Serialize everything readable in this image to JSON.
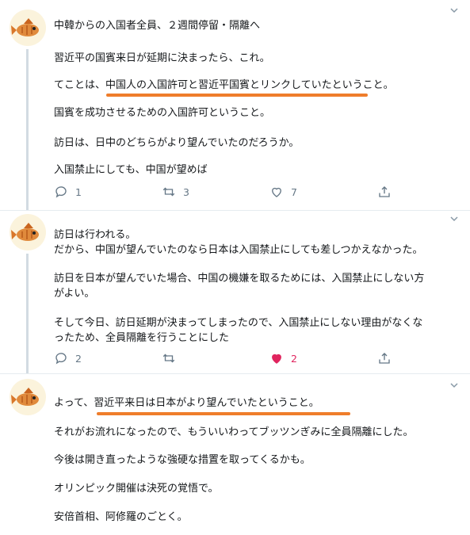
{
  "tweets": [
    {
      "lines": [
        "中韓からの入国者全員、２週間停留・隔離へ",
        "習近平の国賓来日が延期に決まったら、これ。",
        "てことは、中国人の入国許可と習近平国賓とリンクしていたということ。",
        "国賓を成功させるための入国許可ということ。",
        "訪日は、日中のどちらがより望んでいたのだろうか。",
        "入国禁止にしても、中国が望めば"
      ],
      "replies": "1",
      "retweets": "3",
      "likes": "7"
    },
    {
      "lines": [
        "訪日は行われる。",
        "だから、中国が望んでいたのなら日本は入国禁止にしても差しつかえなかった。",
        "訪日を日本が望んでいた場合、中国の機嫌を取るためには、入国禁止にしない方",
        "がよい。",
        "そして今日、訪日延期が決まってしまったので、入国禁止にしない理由がなくな",
        "ったため、全員隔離を行うことにした"
      ],
      "replies": "2",
      "retweets": "",
      "likes": "2"
    },
    {
      "lines": [
        "よって、習近平来日は日本がより望んでいたということ。",
        "それがお流れになったので、もういいわってブッツンぎみに全員隔離にした。",
        "今後は開き直ったような強硬な措置を取ってくるかも。",
        "オリンピック開催は決死の覚悟で。",
        "安倍首相、阿修羅のごとく。"
      ]
    }
  ],
  "icons": {
    "reply": "reply-icon",
    "retweet": "retweet-icon",
    "like": "heart-icon",
    "share": "share-icon",
    "menu": "chevron-down-icon"
  },
  "colors": {
    "highlight_underline": "#ef7d2b",
    "like_active": "#e0245e",
    "action_gray": "#657786"
  }
}
